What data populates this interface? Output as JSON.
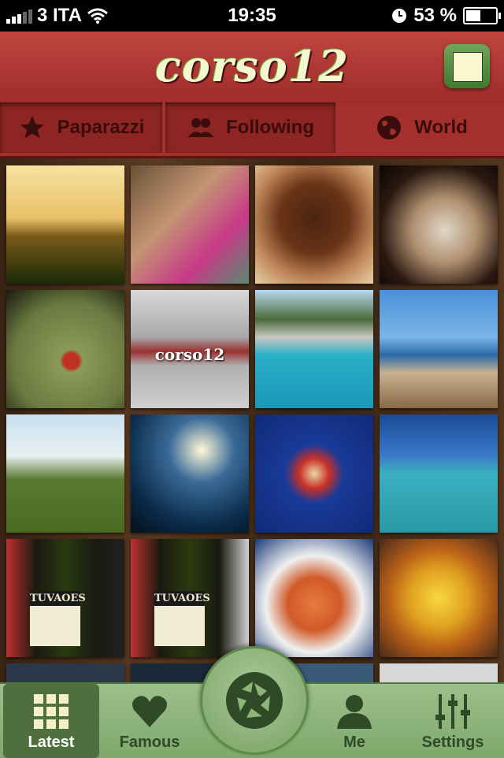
{
  "status_bar": {
    "carrier": "3 ITA",
    "time": "19:35",
    "battery": "53 %",
    "battery_level": 0.53
  },
  "header": {
    "title": "corso12"
  },
  "segments": [
    {
      "label": "Paparazzi",
      "icon": "star-icon"
    },
    {
      "label": "Following",
      "icon": "people-icon"
    },
    {
      "label": "World",
      "icon": "globe-icon"
    }
  ],
  "grid": {
    "tile_texts": {
      "logo_tile": "corso12",
      "wine_label": "TUVAOES"
    }
  },
  "tabbar": {
    "items": [
      {
        "label": "Latest",
        "icon": "grid-icon",
        "active": true
      },
      {
        "label": "Famous",
        "icon": "heart-icon",
        "active": false
      },
      {
        "label": "",
        "icon": "camera-shutter-icon",
        "active": false
      },
      {
        "label": "Me",
        "icon": "person-icon",
        "active": false
      },
      {
        "label": "Settings",
        "icon": "sliders-icon",
        "active": false
      }
    ]
  },
  "colors": {
    "header_red": "#b03a36",
    "tabbar_green": "#8db57a",
    "active_tab": "#4f6f3f"
  }
}
